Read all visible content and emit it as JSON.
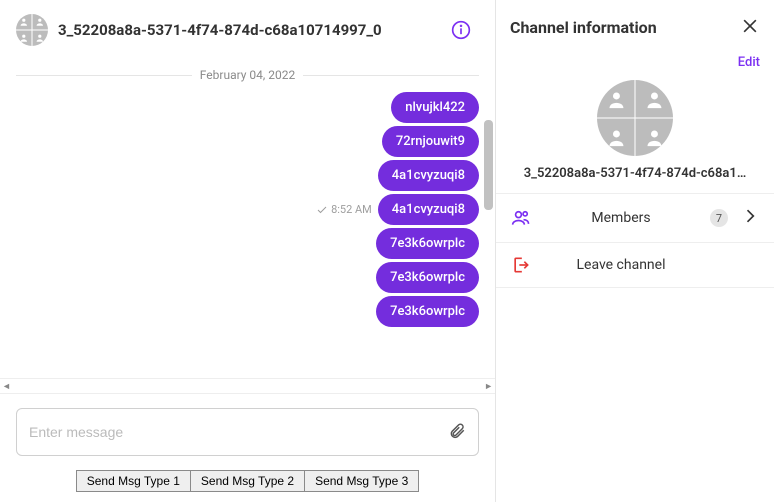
{
  "header": {
    "channel_name": "3_52208a8a-5371-4f74-874d-c68a10714997_0"
  },
  "date_separator": "February 04, 2022",
  "messages": [
    {
      "text": "nlvujkl422",
      "time": "",
      "check": false
    },
    {
      "text": "72rnjouwit9",
      "time": "",
      "check": false
    },
    {
      "text": "4a1cvyzuqi8",
      "time": "",
      "check": false
    },
    {
      "text": "4a1cvyzuqi8",
      "time": "8:52 AM",
      "check": true
    },
    {
      "text": "7e3k6owrplc",
      "time": "",
      "check": false
    },
    {
      "text": "7e3k6owrplc",
      "time": "",
      "check": false
    },
    {
      "text": "7e3k6owrplc",
      "time": "",
      "check": false
    }
  ],
  "composer": {
    "placeholder": "Enter message",
    "buttons": [
      "Send Msg Type 1",
      "Send Msg Type 2",
      "Send Msg Type 3"
    ]
  },
  "panel": {
    "title": "Channel information",
    "edit": "Edit",
    "channel_name_display": "3_52208a8a-5371-4f74-874d-c68a1…",
    "members_label": "Members",
    "members_count": "7",
    "leave_label": "Leave channel"
  }
}
